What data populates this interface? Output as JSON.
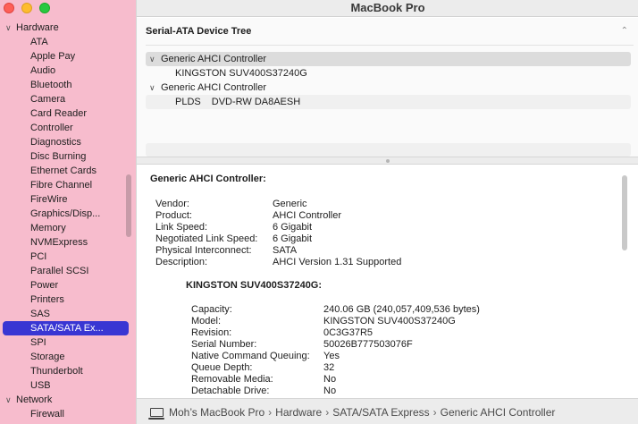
{
  "window": {
    "title": "MacBook Pro"
  },
  "sidebar": {
    "groups": [
      {
        "label": "Hardware",
        "items": [
          "ATA",
          "Apple Pay",
          "Audio",
          "Bluetooth",
          "Camera",
          "Card Reader",
          "Controller",
          "Diagnostics",
          "Disc Burning",
          "Ethernet Cards",
          "Fibre Channel",
          "FireWire",
          "Graphics/Disp...",
          "Memory",
          "NVMExpress",
          "PCI",
          "Parallel SCSI",
          "Power",
          "Printers",
          "SAS",
          "SATA/SATA Ex...",
          "SPI",
          "Storage",
          "Thunderbolt",
          "USB"
        ]
      },
      {
        "label": "Network",
        "items": [
          "Firewall"
        ]
      }
    ],
    "selected": "SATA/SATA Ex..."
  },
  "device_tree": {
    "title": "Serial-ATA Device Tree",
    "controllers": [
      {
        "label": "Generic AHCI Controller",
        "device": "KINGSTON SUV400S37240G",
        "device_type": ""
      },
      {
        "label": "Generic AHCI Controller",
        "device": "DVD-RW DA8AESH",
        "device_type": "PLDS"
      }
    ]
  },
  "details": {
    "title": "Generic AHCI Controller:",
    "fields": [
      {
        "k": "Vendor:",
        "v": "Generic"
      },
      {
        "k": "Product:",
        "v": "AHCI Controller"
      },
      {
        "k": "Link Speed:",
        "v": "6 Gigabit"
      },
      {
        "k": "Negotiated Link Speed:",
        "v": "6 Gigabit"
      },
      {
        "k": "Physical Interconnect:",
        "v": "SATA"
      },
      {
        "k": "Description:",
        "v": "AHCI Version 1.31 Supported"
      }
    ],
    "subtitle": "KINGSTON SUV400S37240G:",
    "subfields": [
      {
        "k": "Capacity:",
        "v": "240.06 GB (240,057,409,536 bytes)"
      },
      {
        "k": "Model:",
        "v": "KINGSTON SUV400S37240G"
      },
      {
        "k": "Revision:",
        "v": "0C3G37R5"
      },
      {
        "k": "Serial Number:",
        "v": "50026B777503076F"
      },
      {
        "k": "Native Command Queuing:",
        "v": "Yes"
      },
      {
        "k": "Queue Depth:",
        "v": "32"
      },
      {
        "k": "Removable Media:",
        "v": "No"
      },
      {
        "k": "Detachable Drive:",
        "v": "No"
      }
    ]
  },
  "path_bar": {
    "items": [
      "Moh’s MacBook Pro",
      "Hardware",
      "SATA/SATA Express",
      "Generic AHCI Controller"
    ],
    "separator": "›"
  },
  "icons": {
    "computer": "laptop-icon",
    "disclosure_open": "chevron-down-icon",
    "collapse": "chevron-up-icon"
  }
}
